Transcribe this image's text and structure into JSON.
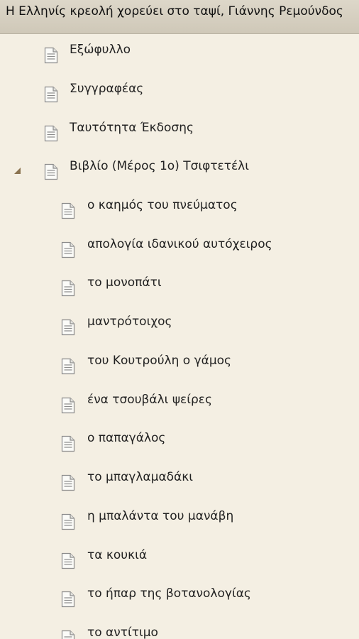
{
  "title": "Η Ελληνίς κρεολή χορεύει στο ταψί, Γιάννης Ρεμούνδος",
  "toc": {
    "top_items": [
      {
        "label": "Εξώφυλλο"
      },
      {
        "label": "Συγγραφέας"
      },
      {
        "label": "Ταυτότητα Έκδοσης"
      },
      {
        "label": "Βιβλίο (Μέρος 1ο) Τσιφτετέλι",
        "expanded": true
      }
    ],
    "children": [
      {
        "label": "ο καημός του πνεύματος"
      },
      {
        "label": "απολογία ιδανικού αυτόχειρος"
      },
      {
        "label": "το μονοπάτι"
      },
      {
        "label": "μαντρότοιχος"
      },
      {
        "label": "του Κουτρούλη ο γάμος"
      },
      {
        "label": "ένα τσουβάλι ψείρες"
      },
      {
        "label": "ο παπαγάλος"
      },
      {
        "label": "το μπαγλαμαδάκι"
      },
      {
        "label": "η μπαλάντα του μανάβη"
      },
      {
        "label": "τα κουκιά"
      },
      {
        "label": "το ήπαρ της βοτανολογίας"
      },
      {
        "label": "το αντίτιμο"
      }
    ]
  },
  "icons": {
    "item": "document-icon",
    "expander": "expanded-triangle-icon"
  },
  "colors": {
    "background": "#f4efe3",
    "titlebar": "#d6d0c1",
    "expander": "#8a7350",
    "icon": "#8c8c8c"
  }
}
